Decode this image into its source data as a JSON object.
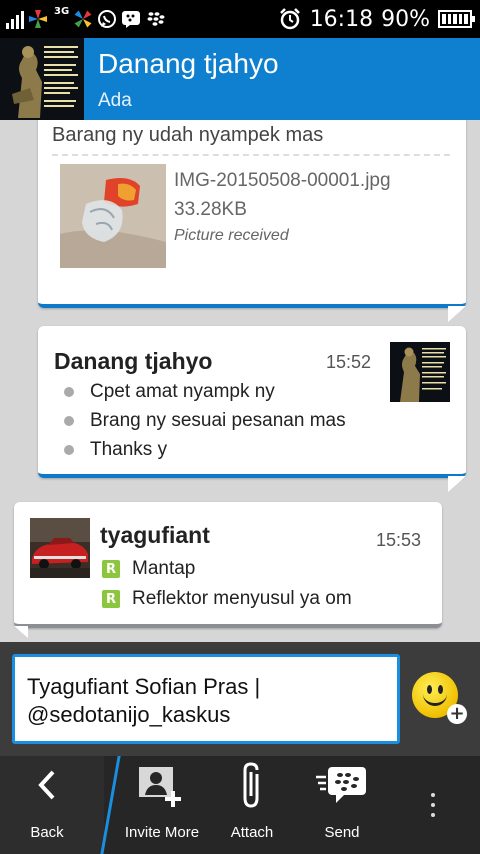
{
  "status_bar": {
    "network": "3G",
    "time": "16:18",
    "battery_percent": "90%",
    "battery_level": 0.9,
    "icons": [
      "signal-icon",
      "pinwheel-icon",
      "whatsapp-icon",
      "bbm-icon",
      "blackberry-icon",
      "alarm-icon",
      "battery-icon"
    ]
  },
  "header": {
    "contact_name": "Danang tjahyo",
    "contact_status": "Ada",
    "avatar_alt": "statue-avatar"
  },
  "messages": [
    {
      "caption": "Barang ny udah nyampek mas",
      "file_name": "IMG-20150508-00001.jpg",
      "file_size": "33.28KB",
      "file_status": "Picture received"
    },
    {
      "sender": "Danang tjahyo",
      "time": "15:52",
      "lines": [
        "Cpet amat nyampk ny",
        "Brang ny sesuai pesanan mas",
        "Thanks y"
      ]
    },
    {
      "sender": "tyagufiant",
      "time": "15:53",
      "read_marker": "R",
      "lines": [
        "Mantap",
        "Reflektor menyusul ya om"
      ]
    }
  ],
  "composer": {
    "text_line1": "Tyagufiant Sofian Pras |",
    "text_line2": "@sedotanijo_kaskus"
  },
  "action_bar": {
    "back": "Back",
    "invite": "Invite More",
    "attach": "Attach",
    "send": "Send"
  },
  "colors": {
    "header_blue": "#0f7fd0",
    "accent_blue": "#1a8fe0",
    "read_green": "#8cc63f"
  }
}
